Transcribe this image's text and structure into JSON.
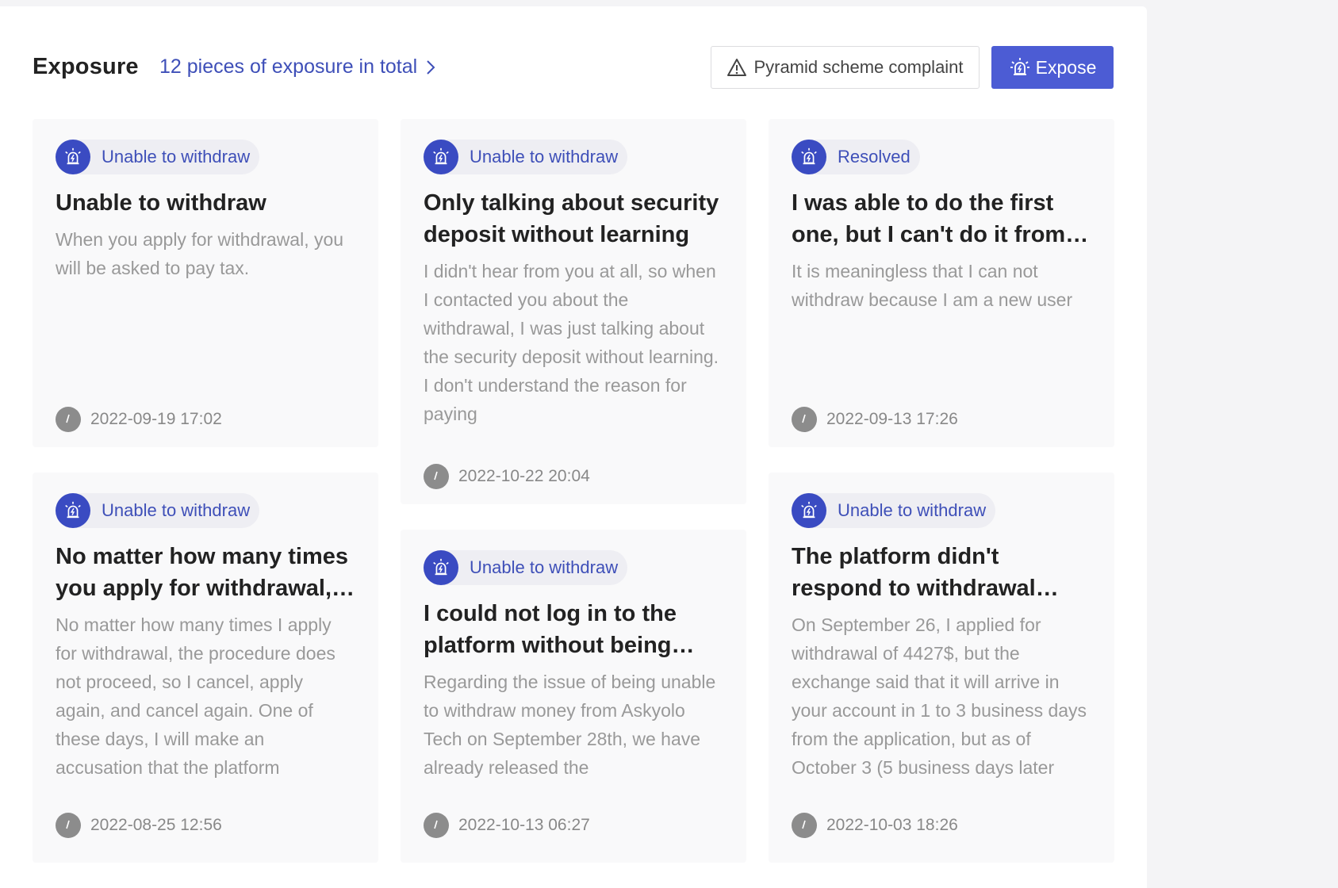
{
  "header": {
    "title": "Exposure",
    "total_link": "12 pieces of exposure in total",
    "complaint_button": "Pyramid scheme complaint",
    "expose_button": "Expose"
  },
  "cards": [
    {
      "tag": "Unable to withdraw",
      "title": "Unable to withdraw",
      "description": "When you apply for withdrawal, you will be asked to pay tax.",
      "time": "2022-09-19 17:02"
    },
    {
      "tag": "Unable to withdraw",
      "title": "Only talking about security deposit without learning",
      "description": "I didn't hear from you at all, so when I contacted you about the withdrawal, I was just talking about the security deposit without learning. I don't understand the reason for paying",
      "time": "2022-10-22 20:04"
    },
    {
      "tag": "Resolved",
      "title": "I was able to do the first one, but I can't do it from the second one",
      "description": "It is meaningless that I can not withdraw because I am a new user",
      "time": "2022-09-13 17:26"
    },
    {
      "tag": "Unable to withdraw",
      "title": "No matter how many times you apply for withdrawal, it does not proceed",
      "description": "No matter how many times I apply for withdrawal, the procedure does not proceed, so I cancel, apply again, and cancel again. One of these days, I will make an accusation that the platform",
      "time": "2022-08-25 12:56"
    },
    {
      "tag": "Unable to withdraw",
      "title": "I could not log in to the platform without being able to withdraw",
      "description": "Regarding the issue of being unable to withdraw money from Askyolo Tech on September 28th, we have already released the",
      "time": "2022-10-13 06:27"
    },
    {
      "tag": "Unable to withdraw",
      "title": "The platform didn't respond to withdrawal requests",
      "description": "On September 26, I applied for withdrawal of 4427$, but the exchange said that it will arrive in your account in 1 to 3 business days from the application, but as of October 3 (5 business days later",
      "time": "2022-10-03 18:26"
    }
  ]
}
